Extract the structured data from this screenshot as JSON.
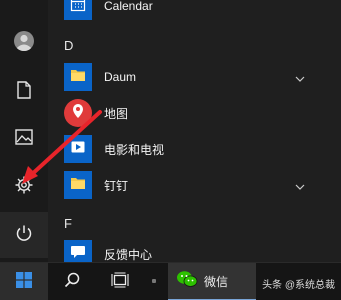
{
  "start_menu": {
    "sections": [
      {
        "letter": "",
        "apps": [
          {
            "label": "Calendar",
            "icon": "calendar-icon",
            "expandable": false
          }
        ]
      },
      {
        "letter": "D",
        "apps": [
          {
            "label": "Daum",
            "icon": "folder-icon",
            "expandable": true
          },
          {
            "label": "地图",
            "icon": "map-pin-icon",
            "expandable": false
          },
          {
            "label": "电影和电视",
            "icon": "play-icon",
            "expandable": false
          },
          {
            "label": "钉钉",
            "icon": "folder-icon",
            "expandable": true
          }
        ]
      },
      {
        "letter": "F",
        "apps": [
          {
            "label": "反馈中心",
            "icon": "feedback-icon",
            "expandable": false
          }
        ]
      }
    ],
    "rail": [
      "avatar",
      "document-icon",
      "pictures-icon",
      "gear-icon",
      "power-icon"
    ]
  },
  "taskbar": {
    "buttons": [
      "windows-logo-icon",
      "search-icon",
      "task-view-icon"
    ],
    "wechat_label": "微信",
    "watermark": "头条 @系统总裁"
  },
  "colors": {
    "accent": "#0a64c8",
    "folder": "#f3c94b",
    "annotation_arrow": "#e8242a",
    "map_red": "#e03b3b",
    "wechat_green": "#2dc100"
  }
}
